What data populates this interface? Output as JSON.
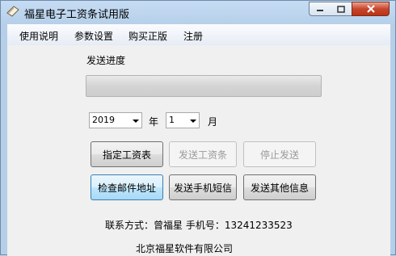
{
  "window": {
    "title": "福星电子工资条试用版"
  },
  "menu": [
    {
      "label": "使用说明"
    },
    {
      "label": "参数设置"
    },
    {
      "label": "购买正版"
    },
    {
      "label": "注册"
    }
  ],
  "progress": {
    "label": "发送进度",
    "value_pct": 0
  },
  "date": {
    "year": "2019",
    "year_unit": "年",
    "month": "1",
    "month_unit": "月"
  },
  "buttons": {
    "specify_payroll": "指定工资表",
    "send_payroll": "发送工资条",
    "stop_send": "停止发送",
    "check_email": "检查邮件地址",
    "send_sms": "发送手机短信",
    "send_other": "发送其他信息"
  },
  "contact": {
    "text": "联系方式：曾福星  手机号：13241233523"
  },
  "company": {
    "text": "北京福星软件有限公司"
  },
  "colors": {
    "titlebar": "#c5dcf3",
    "close_button": "#c8452b",
    "progress_fill": "#36c23a"
  },
  "icons": [
    "app-icon",
    "minimize-icon",
    "maximize-icon",
    "close-icon",
    "dropdown-arrow-icon"
  ]
}
